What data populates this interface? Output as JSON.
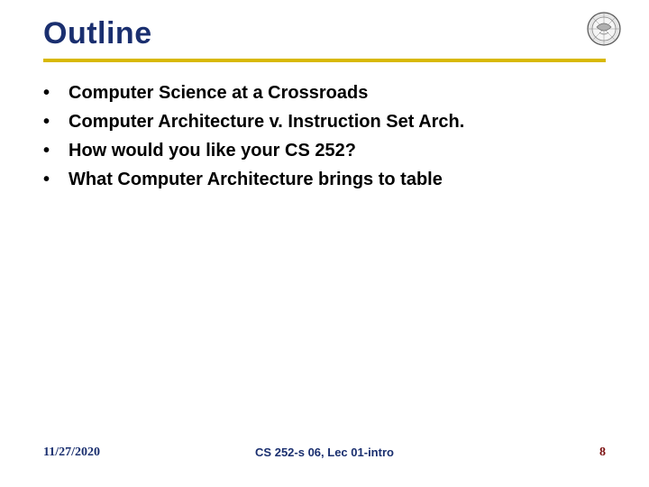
{
  "header": {
    "title": "Outline"
  },
  "bullets": {
    "items": [
      {
        "text": "Computer Science at a Crossroads"
      },
      {
        "text": "Computer Architecture v. Instruction Set Arch."
      },
      {
        "text": "How would you like your CS 252?"
      },
      {
        "text": "What Computer Architecture brings to table"
      }
    ]
  },
  "footer": {
    "date": "11/27/2020",
    "center": "CS 252-s 06, Lec 01-intro",
    "page": "8"
  },
  "colors": {
    "heading": "#1a2f6f",
    "underline": "#d8b800",
    "pageNumber": "#7a0e0e"
  }
}
